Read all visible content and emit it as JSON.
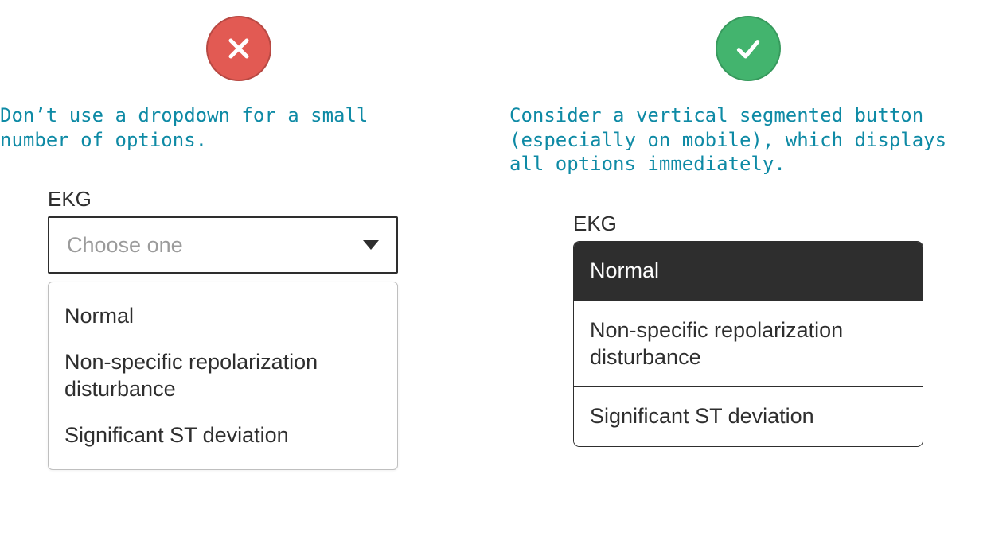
{
  "bad": {
    "caption": "Don’t use a dropdown for a small number of options.",
    "field_label": "EKG",
    "placeholder": "Choose one",
    "options": [
      "Normal",
      "Non-specific repolarization disturbance",
      "Significant ST deviation"
    ]
  },
  "good": {
    "caption": "Consider a vertical segmented button (especially on mobile), which displays all options immediately.",
    "field_label": "EKG",
    "options": [
      "Normal",
      "Non-specific repolarization disturbance",
      "Significant ST deviation"
    ],
    "selected_index": 0
  },
  "colors": {
    "bad_badge": "#e25a53",
    "good_badge": "#43b46e",
    "caption": "#0e8aa5",
    "ink": "#2e2e2e",
    "placeholder": "#9b9b9b"
  }
}
